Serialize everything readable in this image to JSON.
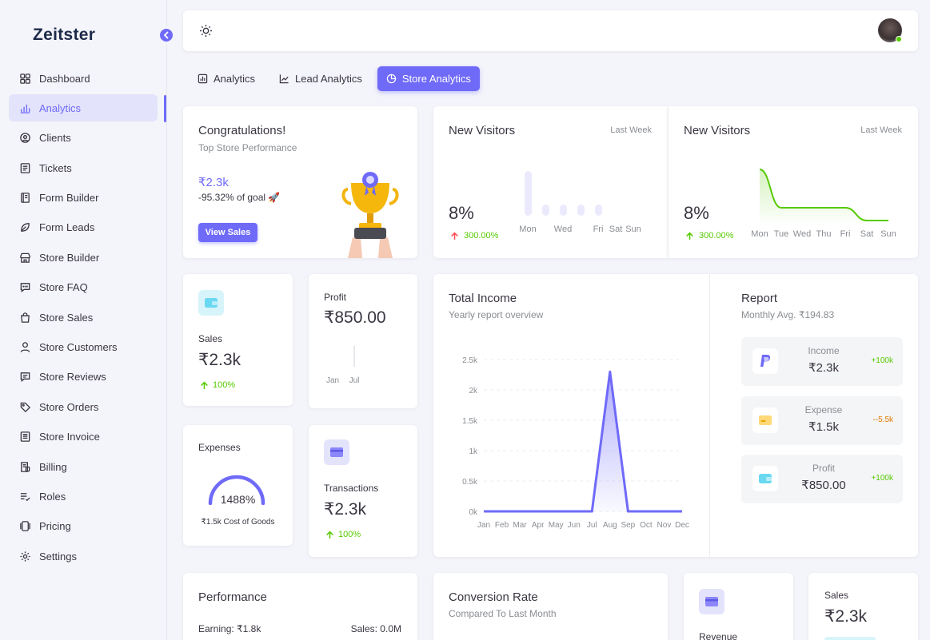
{
  "app": {
    "logo": "Zeitster"
  },
  "sidebar": {
    "items": [
      {
        "label": "Dashboard",
        "icon": "grid-icon"
      },
      {
        "label": "Analytics",
        "icon": "bar-chart-icon",
        "active": true
      },
      {
        "label": "Clients",
        "icon": "user-circle-icon"
      },
      {
        "label": "Tickets",
        "icon": "ticket-icon"
      },
      {
        "label": "Form Builder",
        "icon": "form-icon"
      },
      {
        "label": "Form Leads",
        "icon": "leaf-icon"
      },
      {
        "label": "Store Builder",
        "icon": "store-icon"
      },
      {
        "label": "Store FAQ",
        "icon": "chat-icon"
      },
      {
        "label": "Store Sales",
        "icon": "bag-icon"
      },
      {
        "label": "Store Customers",
        "icon": "user-icon"
      },
      {
        "label": "Store Reviews",
        "icon": "message-icon"
      },
      {
        "label": "Store Orders",
        "icon": "tag-icon"
      },
      {
        "label": "Store Invoice",
        "icon": "invoice-icon"
      },
      {
        "label": "Billing",
        "icon": "billing-icon"
      },
      {
        "label": "Roles",
        "icon": "list-check-icon"
      },
      {
        "label": "Pricing",
        "icon": "pricing-icon"
      },
      {
        "label": "Settings",
        "icon": "gear-icon"
      }
    ]
  },
  "tabs": [
    {
      "label": "Analytics",
      "icon": "bar-chart-icon"
    },
    {
      "label": "Lead Analytics",
      "icon": "line-chart-icon"
    },
    {
      "label": "Store Analytics",
      "icon": "pie-chart-icon",
      "active": true
    }
  ],
  "congrats": {
    "title": "Congratulations!",
    "subtitle": "Top Store Performance",
    "amount": "₹2.3k",
    "goal": "-95.32% of goal 🚀",
    "button": "View Sales"
  },
  "visitors_bar": {
    "title": "New Visitors",
    "period": "Last Week",
    "value": "8%",
    "change": "300.00%",
    "chart_data": {
      "type": "bar",
      "categories": [
        "Mon",
        "Tue",
        "Wed",
        "Thu",
        "Fri",
        "Sat",
        "Sun"
      ],
      "tick_labels": [
        "Mon",
        "",
        "Wed",
        "",
        "Fri",
        "Sat",
        "Sun"
      ],
      "values": [
        4,
        1,
        1,
        1,
        1,
        0,
        0
      ]
    }
  },
  "visitors_line": {
    "title": "New Visitors",
    "period": "Last Week",
    "value": "8%",
    "change": "300.00%",
    "chart_data": {
      "type": "area",
      "categories": [
        "Mon",
        "Tue",
        "Wed",
        "Thu",
        "Fri",
        "Sat",
        "Sun"
      ],
      "values": [
        4,
        1,
        1,
        1,
        1,
        0,
        0
      ]
    }
  },
  "sales_card": {
    "label": "Sales",
    "value": "₹2.3k",
    "change": "100%"
  },
  "profit_card": {
    "label": "Profit",
    "value": "₹850.00",
    "chart_data": {
      "type": "bar",
      "categories": [
        "Jan",
        "Jul"
      ],
      "values": [
        0,
        850
      ]
    }
  },
  "expenses_card": {
    "label": "Expenses",
    "percent": "1488%",
    "caption": "₹1.5k Cost of Goods"
  },
  "transactions_card": {
    "label": "Transactions",
    "value": "₹2.3k",
    "change": "100%"
  },
  "income": {
    "title": "Total Income",
    "subtitle": "Yearly report overview",
    "chart_data": {
      "type": "area",
      "categories": [
        "Jan",
        "Feb",
        "Mar",
        "Apr",
        "May",
        "Jun",
        "Jul",
        "Aug",
        "Sep",
        "Oct",
        "Nov",
        "Dec"
      ],
      "values": [
        0,
        0,
        0,
        0,
        0,
        0,
        0,
        2300,
        0,
        0,
        0,
        0
      ],
      "ylim": [
        0,
        2500
      ],
      "yticks": [
        "0k",
        "0.5k",
        "1k",
        "1.5k",
        "2k",
        "2.5k"
      ]
    }
  },
  "report": {
    "title": "Report",
    "subtitle": "Monthly Avg. ₹194.83",
    "rows": [
      {
        "label": "Income",
        "value": "₹2.3k",
        "change": "+100k",
        "change_color": "#56ca00",
        "icon": "paypal-icon"
      },
      {
        "label": "Expense",
        "value": "₹1.5k",
        "change": "--5.5k",
        "change_color": "#e07a00",
        "icon": "card-icon"
      },
      {
        "label": "Profit",
        "value": "₹850.00",
        "change": "+100k",
        "change_color": "#56ca00",
        "icon": "wallet-icon"
      }
    ]
  },
  "performance": {
    "title": "Performance",
    "earning": "Earning: ₹1.8k",
    "sales": "Sales: 0.0M"
  },
  "conversion": {
    "title": "Conversion Rate",
    "subtitle": "Compared To Last Month"
  },
  "revenue_card": {
    "label": "Revenue"
  },
  "sales_card2": {
    "label": "Sales",
    "value": "₹2.3k"
  },
  "colors": {
    "accent": "#6f6af8",
    "success": "#56ca00",
    "warning": "#e07a00"
  }
}
